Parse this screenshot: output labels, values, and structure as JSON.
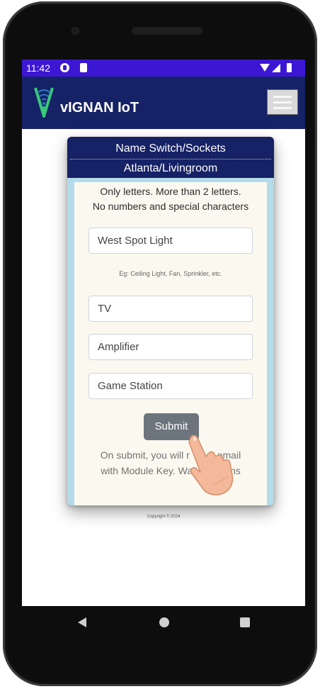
{
  "status_bar": {
    "time": "11:42"
  },
  "app_bar": {
    "brand": "vIGNAN IoT"
  },
  "dialog": {
    "title": "Name Switch/Sockets",
    "subtitle": "Atlanta/Livingroom",
    "instructions_line1": "Only letters. More than 2 letters.",
    "instructions_line2": "No numbers and special characters",
    "fields": [
      {
        "value": "West Spot Light"
      },
      {
        "value": "TV"
      },
      {
        "value": "Amplifier"
      },
      {
        "value": "Game Station"
      }
    ],
    "hint": "Eg: Ceiling Light, Fan, Sprinkler, etc.",
    "submit_label": "Submit",
    "note_line1": "On submit, you will r          email",
    "note_line2": "with Module Key. Wait f    2mins"
  },
  "footer": {
    "copyright": "Copyright © 2024"
  },
  "colors": {
    "status_bar": "#3b17d4",
    "app_bar": "#162266",
    "modal_frame": "#b4dbe9",
    "modal_body": "#fbf9ef",
    "submit": "#6c757d",
    "logo_green": "#38c97a"
  },
  "icons": {
    "logo": "wifi-signal-v-logo-icon",
    "menu": "hamburger-menu-icon",
    "pointer": "pointing-hand-icon"
  }
}
